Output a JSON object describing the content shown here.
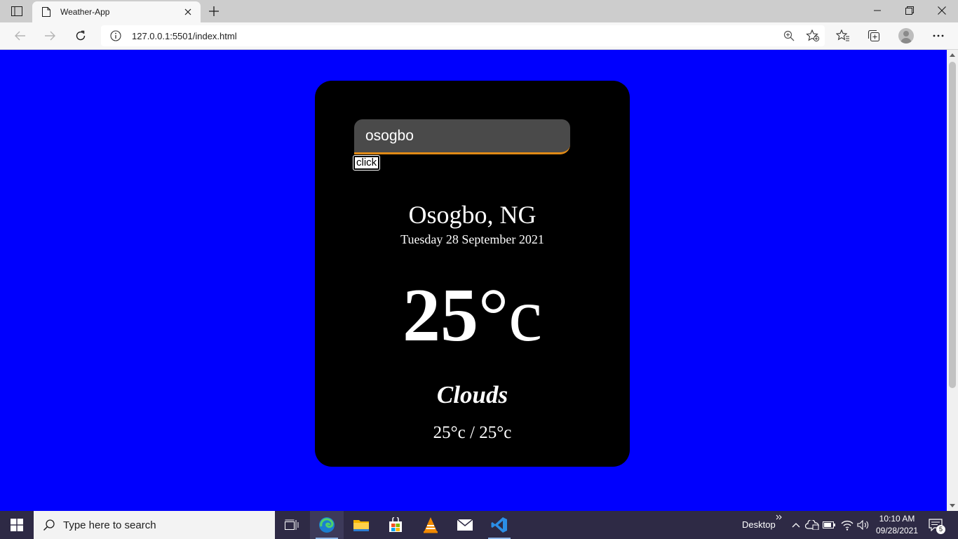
{
  "browser": {
    "tab": {
      "title": "Weather-App",
      "favicon": "page-icon"
    },
    "url": "127.0.0.1:5501/index.html"
  },
  "app": {
    "search_value": "osogbo",
    "button_label": "click",
    "location": "Osogbo, NG",
    "date": "Tuesday 28 September 2021",
    "temp_value": "25",
    "temp_unit": "°c",
    "condition": "Clouds",
    "hi_low": "25°c / 25°c",
    "colors": {
      "page_bg": "#0000fe",
      "card_bg": "#000000",
      "input_bg": "#4a4a4a",
      "input_accent": "#e08a16",
      "text": "#ffffff"
    }
  },
  "taskbar": {
    "search_placeholder": "Type here to search",
    "desktop_label": "Desktop",
    "time": "10:10 AM",
    "date": "09/28/2021",
    "notification_count": "5",
    "pinned": [
      "task-view-icon",
      "edge-icon",
      "file-explorer-icon",
      "store-icon",
      "vlc-icon",
      "mail-icon",
      "vscode-icon"
    ]
  }
}
